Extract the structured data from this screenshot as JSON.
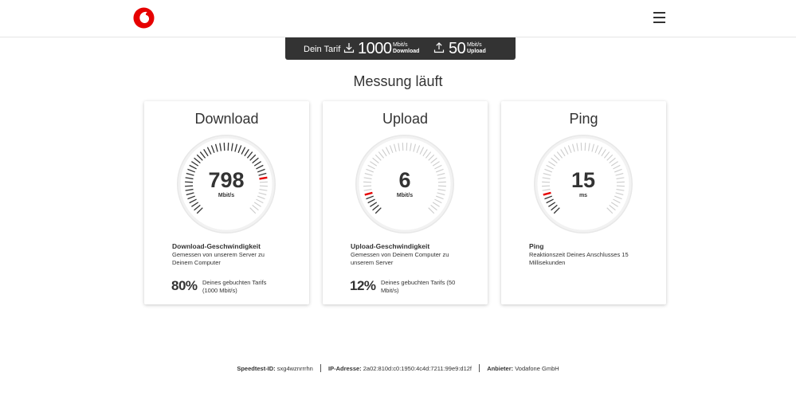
{
  "header": {
    "logo_icon": "vodafone-speechmark-logo",
    "menu_icon": "hamburger-menu-icon",
    "brand_color": "#e60000"
  },
  "tariff": {
    "label": "Dein Tarif",
    "download_value": "1000",
    "download_unit": "Mbit/s",
    "download_label": "Download",
    "upload_value": "50",
    "upload_unit": "Mbit/s",
    "upload_label": "Upload"
  },
  "status": "Messung läuft",
  "cards": [
    {
      "title": "Download",
      "value": "798",
      "unit": "Mbit/s",
      "gauge_fraction": 0.8,
      "desc_title": "Download-Geschwindigkeit",
      "desc_text": "Gemessen von unserem Server zu Deinem Computer",
      "percent": "80%",
      "percent_text": "Deines gebuchten Tarifs (1000 Mbit/s)"
    },
    {
      "title": "Upload",
      "value": "6",
      "unit": "Mbit/s",
      "gauge_fraction": 0.12,
      "desc_title": "Upload-Geschwindigkeit",
      "desc_text": "Gemessen von Deinem Computer zu unserem Server",
      "percent": "12%",
      "percent_text": "Deines gebuchten Tarifs (50 Mbit/s)"
    },
    {
      "title": "Ping",
      "value": "15",
      "unit": "ms",
      "gauge_fraction": 0.1,
      "desc_title": "Ping",
      "desc_text": "Reaktionszeit Deines Anschlusses 15 Millisekunden",
      "percent": "",
      "percent_text": ""
    }
  ],
  "footer": {
    "speedtest_label": "Speedtest-ID:",
    "speedtest_value": "sxg4wznrrrhn",
    "ip_label": "IP-Adresse:",
    "ip_value": "2a02:810d:c0:1950:4c4d:7211:99e9:d12f",
    "provider_label": "Anbieter:",
    "provider_value": "Vodafone GmbH"
  }
}
